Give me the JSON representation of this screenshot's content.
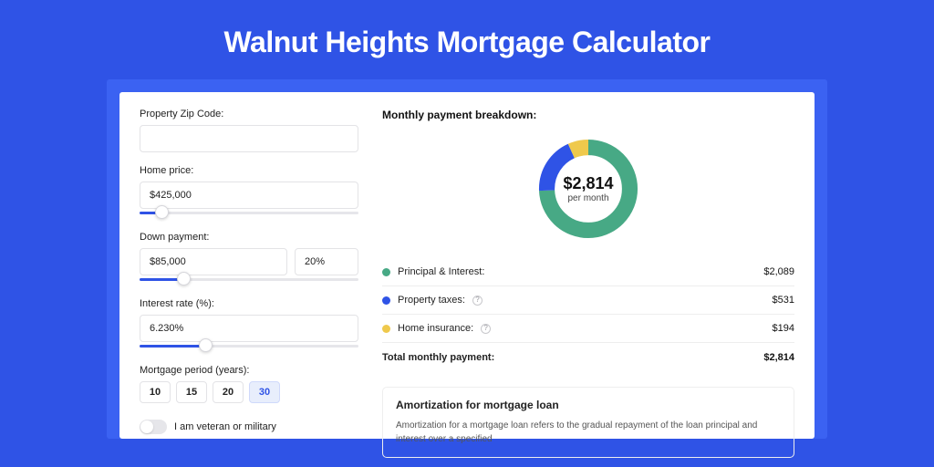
{
  "title": "Walnut Heights Mortgage Calculator",
  "form": {
    "zip_label": "Property Zip Code:",
    "zip_value": "",
    "home_price_label": "Home price:",
    "home_price_value": "$425,000",
    "home_price_pct": 10,
    "down_payment_label": "Down payment:",
    "down_payment_value": "$85,000",
    "down_payment_pct_value": "20%",
    "down_payment_pct": 20,
    "interest_label": "Interest rate (%):",
    "interest_value": "6.230%",
    "interest_pct": 30,
    "period_label": "Mortgage period (years):",
    "periods": [
      "10",
      "15",
      "20",
      "30"
    ],
    "period_active_index": 3,
    "veteran_label": "I am veteran or military",
    "veteran_on": false
  },
  "breakdown": {
    "heading": "Monthly payment breakdown:",
    "total_amount": "$2,814",
    "total_sub": "per month",
    "rows": [
      {
        "label": "Principal & Interest:",
        "value": "$2,089",
        "color": "green",
        "info": false
      },
      {
        "label": "Property taxes:",
        "value": "$531",
        "color": "blue",
        "info": true
      },
      {
        "label": "Home insurance:",
        "value": "$194",
        "color": "yellow",
        "info": true
      }
    ],
    "total_label": "Total monthly payment:",
    "total_value": "$2,814"
  },
  "chart_data": {
    "type": "pie",
    "title": "Monthly payment breakdown",
    "series": [
      {
        "name": "Principal & Interest",
        "value": 2089,
        "color": "#47a985"
      },
      {
        "name": "Property taxes",
        "value": 531,
        "color": "#2f53e6"
      },
      {
        "name": "Home insurance",
        "value": 194,
        "color": "#efc94c"
      }
    ],
    "center_label": "$2,814",
    "center_sub": "per month"
  },
  "amort": {
    "title": "Amortization for mortgage loan",
    "text": "Amortization for a mortgage loan refers to the gradual repayment of the loan principal and interest over a specified"
  }
}
